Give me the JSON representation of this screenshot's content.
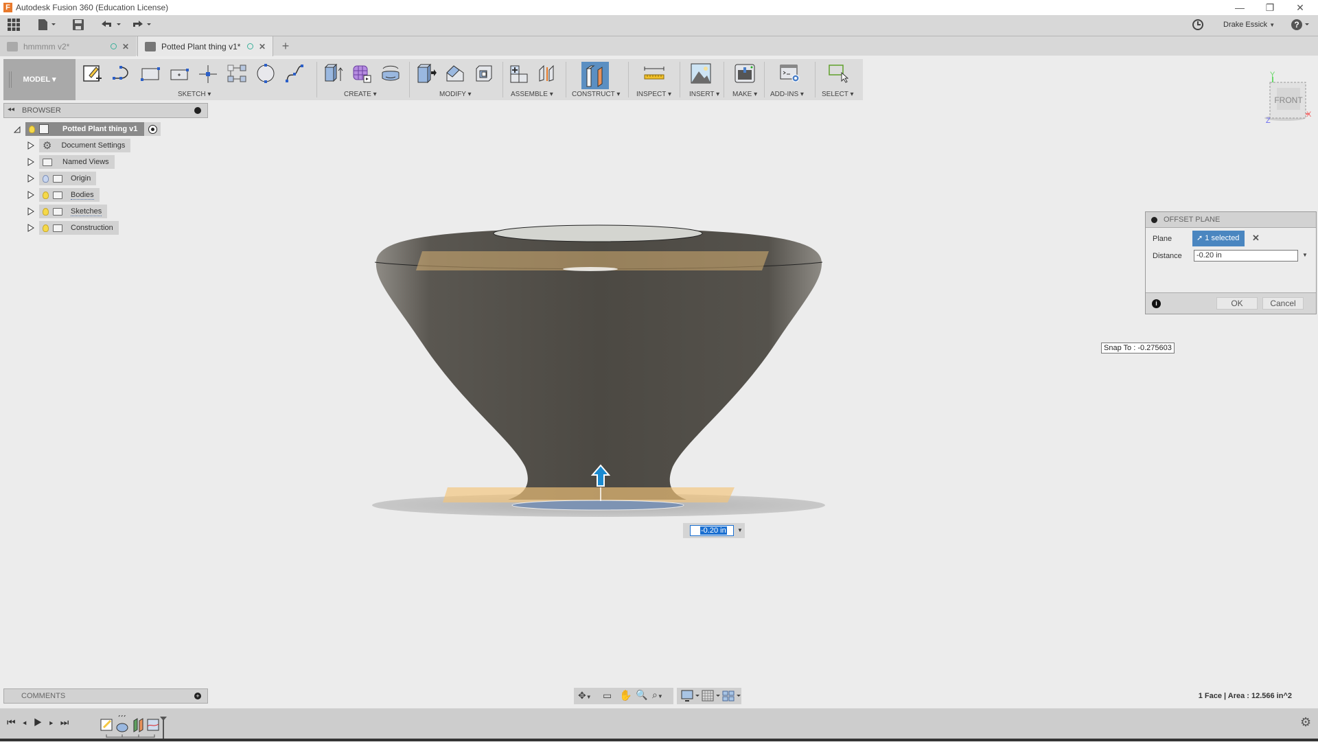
{
  "app": {
    "title": "Autodesk Fusion 360 (Education License)",
    "logo_letter": "F"
  },
  "window_controls": {
    "minimize": "—",
    "restore": "❐",
    "close": "✕"
  },
  "quickbar": {
    "user": "Drake Essick",
    "icons": [
      "apps-grid-icon",
      "file-icon",
      "save-icon",
      "undo-icon",
      "redo-icon",
      "job-status-icon",
      "help-icon"
    ]
  },
  "tabs": [
    {
      "label": "hmmmm v2*",
      "active": false
    },
    {
      "label": "Potted Plant thing v1*",
      "active": true
    }
  ],
  "new_tab_label": "+",
  "toolbar": {
    "workspace": "MODEL ▾",
    "groups": [
      {
        "label": "SKETCH ▾"
      },
      {
        "label": "CREATE ▾"
      },
      {
        "label": "MODIFY ▾"
      },
      {
        "label": "ASSEMBLE ▾"
      },
      {
        "label": "CONSTRUCT ▾"
      },
      {
        "label": "INSPECT ▾"
      },
      {
        "label": "INSERT ▾"
      },
      {
        "label": "MAKE ▾"
      },
      {
        "label": "ADD-INS ▾"
      },
      {
        "label": "SELECT ▾"
      }
    ]
  },
  "browser": {
    "title": "BROWSER",
    "root": "Potted Plant thing v1",
    "items": [
      {
        "label": "Document Settings",
        "icon": "gear"
      },
      {
        "label": "Named Views",
        "icon": "folder"
      },
      {
        "label": "Origin",
        "icon": "folder",
        "bulb": "off"
      },
      {
        "label": "Bodies",
        "icon": "folder",
        "bulb": "on"
      },
      {
        "label": "Sketches",
        "icon": "folder",
        "bulb": "on"
      },
      {
        "label": "Construction",
        "icon": "folder",
        "bulb": "on"
      }
    ]
  },
  "comments": {
    "title": "COMMENTS"
  },
  "viewcube": {
    "face": "FRONT",
    "axes": {
      "x": "X",
      "y": "Y",
      "z": "Z"
    },
    "x_color": "#f06b6b",
    "y_color": "#6ad86a",
    "z_color": "#6a6af0"
  },
  "dialog": {
    "title": "OFFSET PLANE",
    "plane_label": "Plane",
    "plane_value": "1 selected",
    "distance_label": "Distance",
    "distance_value": "-0.20 in",
    "ok": "OK",
    "cancel": "Cancel",
    "accent": "#4a86c0"
  },
  "snap_tooltip": "Snap To : -0.275603",
  "inline_distance": "-0.20 in",
  "status": "1 Face | Area : 12.566 in^2",
  "colors": {
    "body": "#4f4c47",
    "plane": "#f5c57a",
    "selection_blue": "#1a8ad0"
  }
}
